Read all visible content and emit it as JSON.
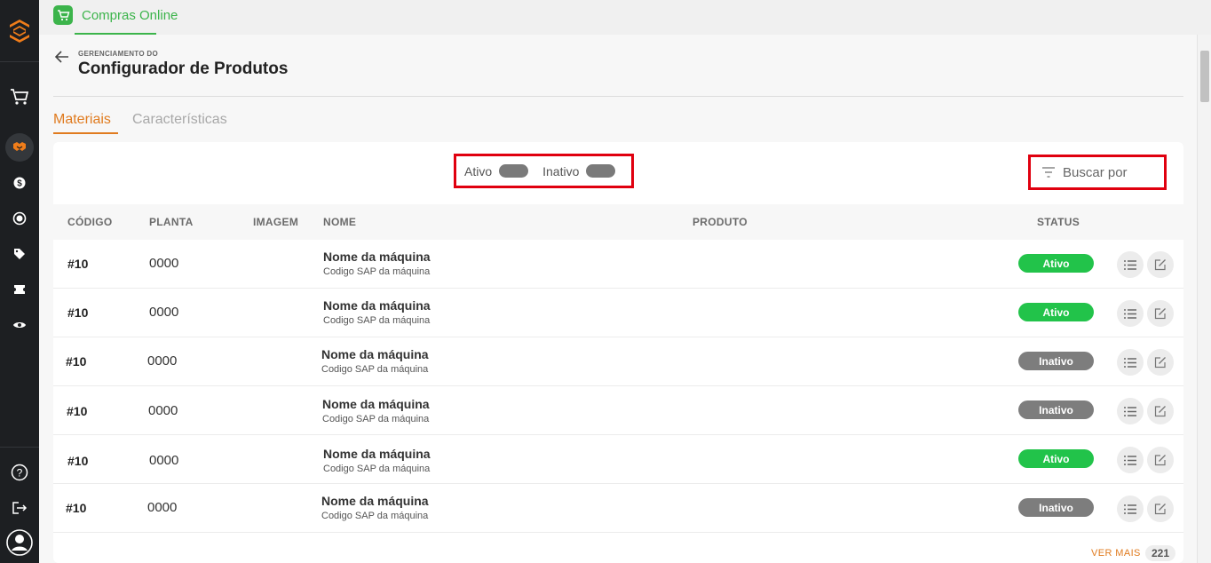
{
  "app": {
    "name": "Compras Online",
    "accent": "#3cb44b"
  },
  "colors": {
    "orange": "#e07b1f",
    "active_badge": "#22c34a",
    "inactive_badge": "#7d7d7d",
    "highlight": "#e0000f"
  },
  "header": {
    "breadcrumb": "GERENCIAMENTO DO",
    "title": "Configurador de Produtos"
  },
  "tabs": [
    {
      "label": "Materiais",
      "active": true
    },
    {
      "label": "Características",
      "active": false
    }
  ],
  "filters": {
    "active_label": "Ativo",
    "inactive_label": "Inativo",
    "search_placeholder": "Buscar por"
  },
  "table": {
    "columns": [
      "CÓDIGO",
      "PLANTA",
      "IMAGEM",
      "NOME",
      "PRODUTO",
      "STATUS"
    ],
    "rows": [
      {
        "code": "#10",
        "plant": "0000",
        "name": "Nome da máquina",
        "sub": "Codigo SAP da máquina",
        "status": "Ativo"
      },
      {
        "code": "#10",
        "plant": "0000",
        "name": "Nome da máquina",
        "sub": "Codigo SAP da máquina",
        "status": "Ativo"
      },
      {
        "code": "#10",
        "plant": "0000",
        "name": "Nome da máquina",
        "sub": "Codigo SAP da máquina",
        "status": "Inativo"
      },
      {
        "code": "#10",
        "plant": "0000",
        "name": "Nome da máquina",
        "sub": "Codigo SAP da máquina",
        "status": "Inativo"
      },
      {
        "code": "#10",
        "plant": "0000",
        "name": "Nome da máquina",
        "sub": "Codigo SAP da máquina",
        "status": "Ativo"
      },
      {
        "code": "#10",
        "plant": "0000",
        "name": "Nome da máquina",
        "sub": "Codigo SAP da máquina",
        "status": "Inativo"
      }
    ]
  },
  "footer": {
    "more_label": "VER MAIS",
    "count": "221"
  },
  "sidebar_icons": [
    "logo-icon",
    "cart-icon",
    "handshake-icon",
    "dollar-icon",
    "exchange-icon",
    "tag-icon",
    "ticket-icon",
    "eye-icon",
    "help-icon",
    "logout-icon",
    "user-icon"
  ]
}
